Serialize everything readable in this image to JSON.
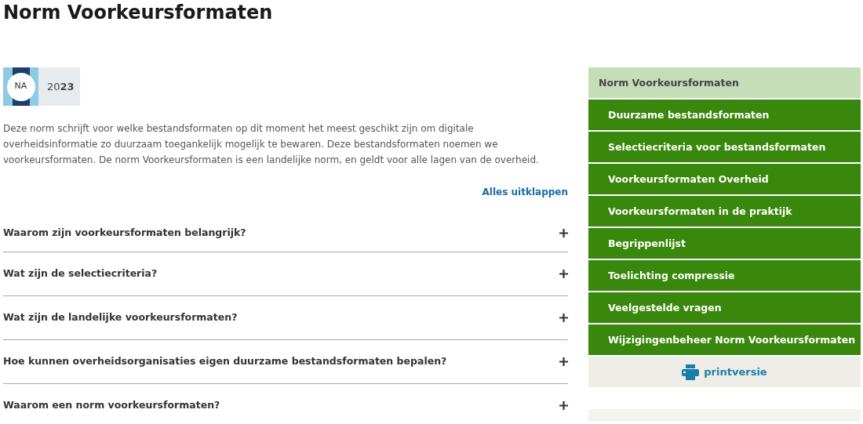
{
  "page_title": "Norm Voorkeursformaten",
  "status_badge": {
    "label": "NA",
    "year": "20**23**"
  },
  "intro": "Deze norm schrijft voor welke bestandsformaten op dit moment het meest geschikt zijn om digitale overheidsinformatie zo duurzaam toegankelijk mogelijk te bewaren. Deze bestandsformaten noemen we voorkeursformaten. De norm Voorkeursformaten is een landelijke norm, en geldt voor alle lagen van de overheid.",
  "expand_all": "Alles uitklappen",
  "accordion": [
    {
      "question": "Waarom zijn voorkeursformaten belangrijk?",
      "expanded": false
    },
    {
      "question": "Wat zijn de selectiecriteria?",
      "expanded": false
    },
    {
      "question": "Wat zijn de landelijke voorkeursformaten?",
      "expanded": false
    },
    {
      "question": "Hoe kunnen overheidsorganisaties eigen duurzame bestandsformaten bepalen?",
      "expanded": false
    },
    {
      "question": "Waarom een norm voorkeursformaten?",
      "expanded": false
    }
  ],
  "sidebar": {
    "items": [
      {
        "label": "Norm Voorkeursformaten",
        "selected": true
      },
      {
        "label": "Duurzame bestandsformaten",
        "selected": false
      },
      {
        "label": "Selectiecriteria voor bestandsformaten",
        "selected": false
      },
      {
        "label": "Voorkeursformaten Overheid",
        "selected": false
      },
      {
        "label": "Voorkeursformaten in de praktijk",
        "selected": false
      },
      {
        "label": "Begrippenlijst",
        "selected": false
      },
      {
        "label": "Toelichting compressie",
        "selected": false
      },
      {
        "label": "Veelgestelde vragen",
        "selected": false
      },
      {
        "label": "Wijzigingenbeheer Norm Voorkeursformaten",
        "selected": false
      }
    ],
    "print_link": "printversie"
  }
}
